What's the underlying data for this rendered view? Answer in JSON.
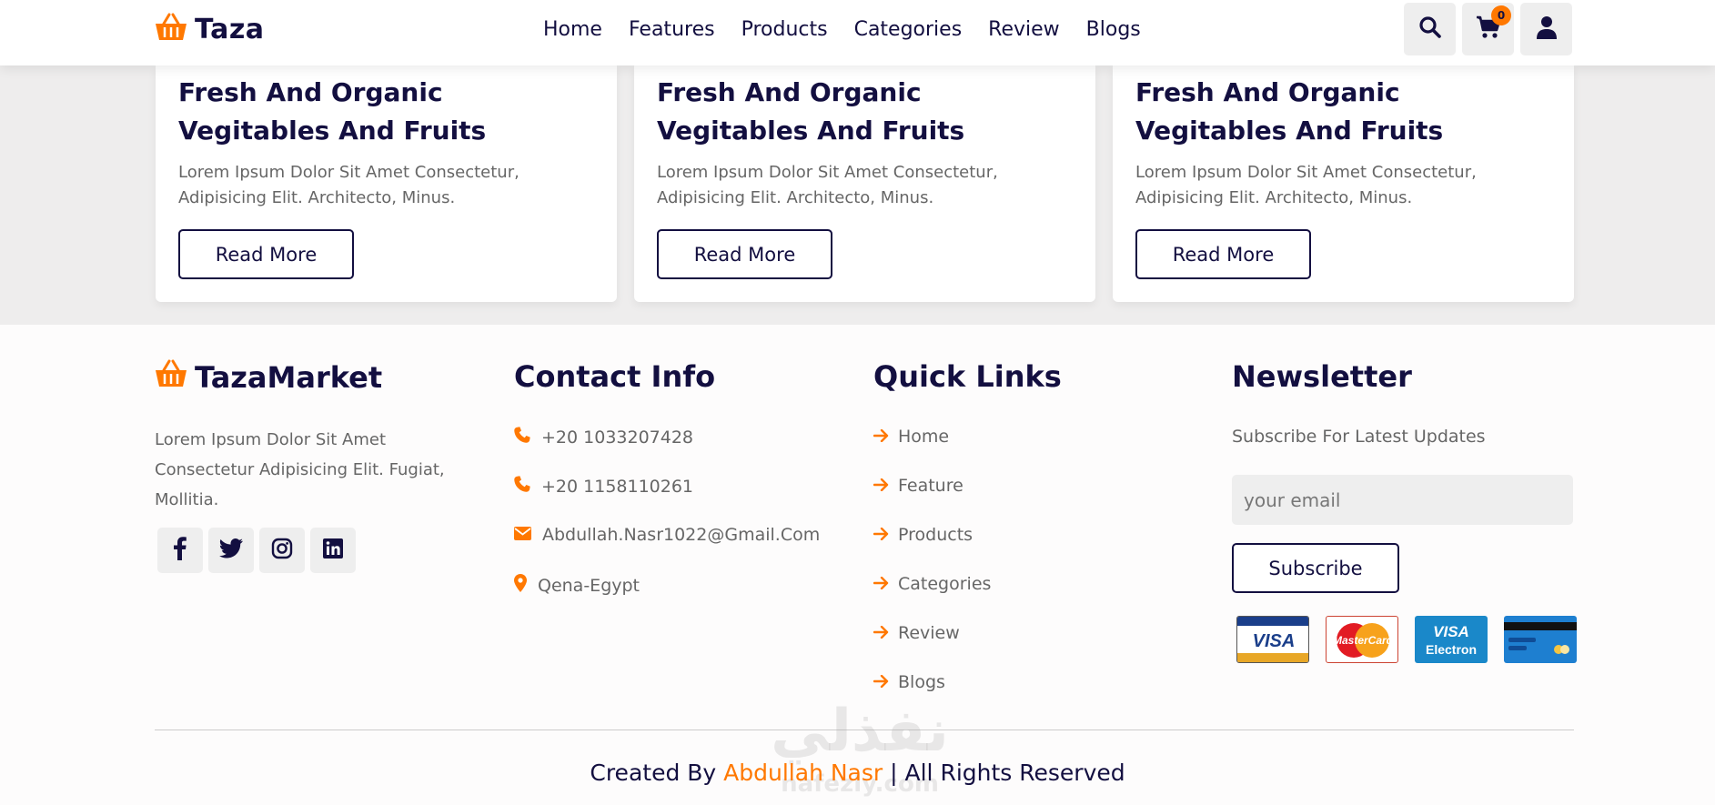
{
  "header": {
    "logo_text": "Taza",
    "nav": [
      "Home",
      "Features",
      "Products",
      "Categories",
      "Review",
      "Blogs"
    ],
    "cart_count": "0",
    "icons": [
      "search-icon",
      "cart-icon",
      "user-icon"
    ]
  },
  "blogs": [
    {
      "title": "Fresh And Organic Vegitables And Fruits",
      "text": "Lorem Ipsum Dolor Sit Amet Consectetur, Adipisicing Elit. Architecto, Minus.",
      "button": "Read More"
    },
    {
      "title": "Fresh And Organic Vegitables And Fruits",
      "text": "Lorem Ipsum Dolor Sit Amet Consectetur, Adipisicing Elit. Architecto, Minus.",
      "button": "Read More"
    },
    {
      "title": "Fresh And Organic Vegitables And Fruits",
      "text": "Lorem Ipsum Dolor Sit Amet Consectetur, Adipisicing Elit. Architecto, Minus.",
      "button": "Read More"
    }
  ],
  "footer": {
    "brand": {
      "name": "TazaMarket",
      "text": "Lorem Ipsum Dolor Sit Amet Consectetur Adipisicing Elit. Fugiat, Mollitia.",
      "socials": [
        "facebook-icon",
        "twitter-icon",
        "instagram-icon",
        "linkedin-icon"
      ]
    },
    "contact": {
      "title": "Contact Info",
      "phone1": "+20 1033207428",
      "phone2": "+20 1158110261",
      "email": "Abdullah.Nasr1022@Gmail.Com",
      "location": "Qena-Egypt"
    },
    "links": {
      "title": "Quick Links",
      "items": [
        "Home",
        "Feature",
        "Products",
        "Categories",
        "Review",
        "Blogs"
      ]
    },
    "newsletter": {
      "title": "Newsletter",
      "text": "Subscribe For Latest Updates",
      "placeholder": "your email",
      "button": "Subscribe",
      "payment_cards": [
        "visa",
        "mastercard",
        "visa-electron",
        "generic-card"
      ]
    },
    "credit": {
      "prefix": "Created By",
      "author": "Abdullah Nasr",
      "suffix": "| All Rights Reserved"
    },
    "watermark": {
      "arabic": "نفذلي",
      "latin": "nafezly.com"
    }
  },
  "colors": {
    "accent": "#ff7800",
    "dark": "#130f40",
    "text": "#666666",
    "light_bg": "#eeeeee"
  }
}
